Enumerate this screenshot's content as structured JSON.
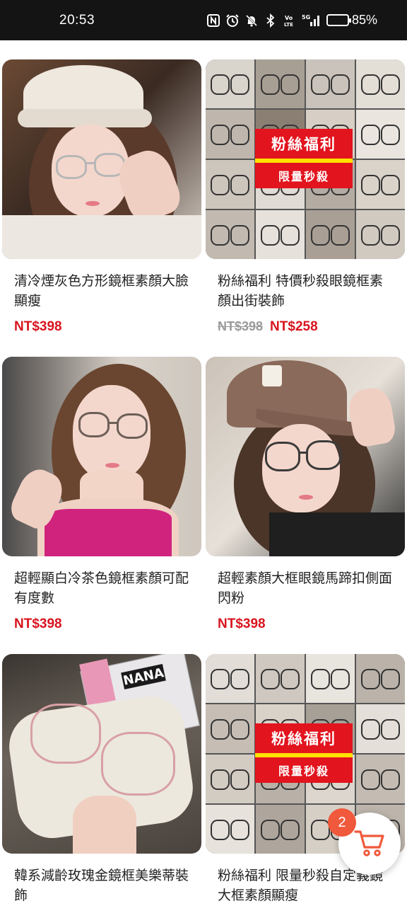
{
  "status_bar": {
    "time": "20:53",
    "battery_percent": "85%",
    "battery_level": 0.85,
    "icons": [
      "nfc-icon",
      "alarm-icon",
      "mute-icon",
      "bluetooth-icon",
      "volte-icon",
      "signal-5g-icon",
      "battery-icon"
    ],
    "volte_label": "Vo\nLTE",
    "network_label": "5G"
  },
  "products": [
    {
      "title": "清冷煙灰色方形鏡框素顏大臉顯瘦",
      "price": "NT$398",
      "old_price": "",
      "image": "portrait-white-hat"
    },
    {
      "title": "粉絲福利 特價秒殺眼鏡框素顏出街裝飾",
      "price": "NT$258",
      "old_price": "NT$398",
      "image": "promo-collage",
      "promo_big": "粉絲福利",
      "promo_small": "限量秒殺"
    },
    {
      "title": "超輕顯白冷茶色鏡框素顏可配有度數",
      "price": "NT$398",
      "old_price": "",
      "image": "portrait-pink-top"
    },
    {
      "title": "超輕素顏大框眼鏡馬蹄扣側面閃粉",
      "price": "NT$398",
      "old_price": "",
      "image": "portrait-brown-cap"
    },
    {
      "title": "韓系減齡玫瑰金鏡框美樂蒂裝飾",
      "price": "",
      "old_price": "",
      "image": "glasses-case",
      "magazine_text": "NANA"
    },
    {
      "title": "粉絲福利 限量秒殺自定義鏡大框素顏顯瘦",
      "price": "",
      "old_price": "",
      "image": "promo-collage",
      "promo_big": "粉絲福利",
      "promo_small": "限量秒殺"
    }
  ],
  "cart": {
    "badge_count": "2",
    "icon": "cart-icon"
  },
  "colors": {
    "price_red": "#d8141e",
    "promo_red": "#e2141e",
    "promo_yellow": "#ffe100",
    "badge_orange": "#f0593c",
    "cart_icon": "#f0593c"
  }
}
